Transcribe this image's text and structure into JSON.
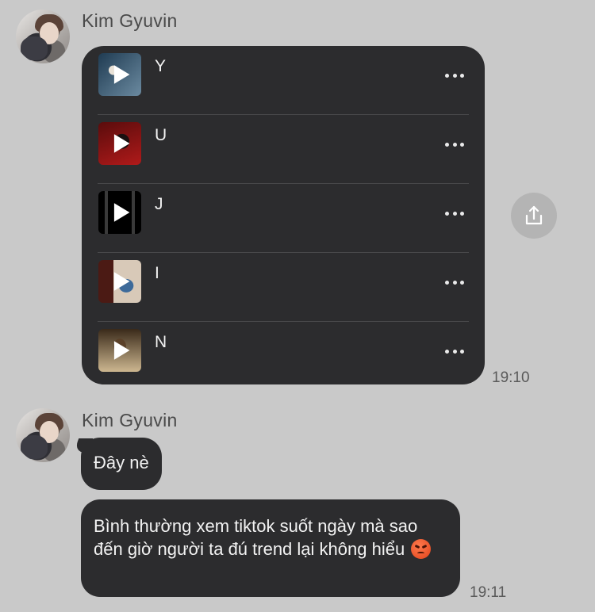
{
  "messages": [
    {
      "sender": "Kim Gyuvin",
      "type": "playlist",
      "tracks": [
        {
          "title": "Y",
          "cover_colors": [
            "#1f3b52",
            "#6b8aa0"
          ]
        },
        {
          "title": "U",
          "cover_colors": [
            "#5a0c0c",
            "#b01a1a"
          ]
        },
        {
          "title": "J",
          "cover_colors": [
            "#000000",
            "#3a3a3a"
          ]
        },
        {
          "title": "I",
          "cover_colors": [
            "#4b1a14",
            "#d8c9b8"
          ]
        },
        {
          "title": "N",
          "cover_colors": [
            "#3a2a1a",
            "#cdb790"
          ]
        }
      ],
      "time": "19:10"
    },
    {
      "sender": "Kim Gyuvin",
      "bubbles": [
        {
          "text": "Đây nè"
        },
        {
          "text": "Bình thường xem tiktok suốt ngày mà sao đến giờ người ta đú trend lại không hiểu",
          "emoji": "angry-face"
        }
      ],
      "time": "19:11"
    }
  ],
  "colors": {
    "background": "#c9c9c9",
    "bubble": "#2c2c2e",
    "bubble_text": "#f2f2f2",
    "share_button": "#b4b4b4"
  }
}
